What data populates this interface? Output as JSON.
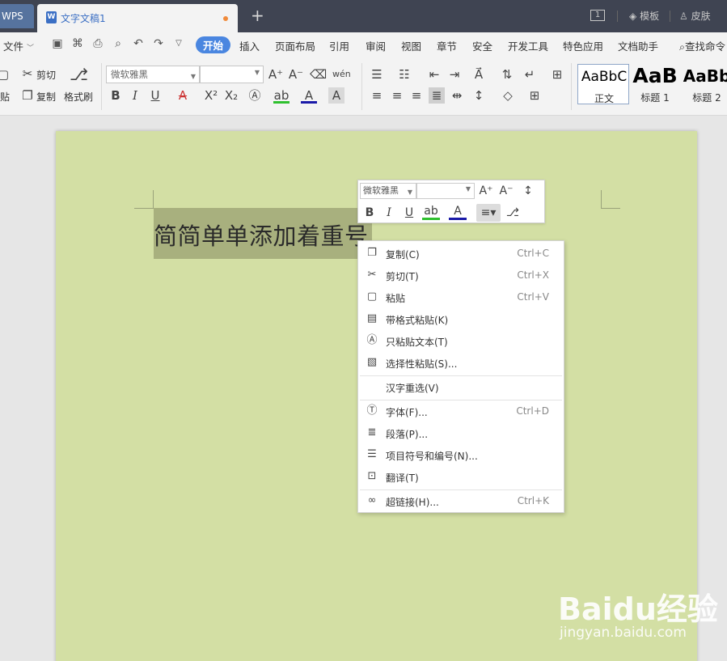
{
  "titlebar": {
    "app_tab": "WPS",
    "doc_tab": "文字文稿1",
    "doc_icon": "W",
    "add_tab": "+",
    "page_count": "1",
    "template": "模板",
    "skin": "皮肤"
  },
  "menubar": {
    "file": "文件",
    "tabs": [
      "开始",
      "插入",
      "页面布局",
      "引用",
      "审阅",
      "视图",
      "章节",
      "安全",
      "开发工具",
      "特色应用",
      "文档助手"
    ],
    "search": "查找命令"
  },
  "ribbon": {
    "cut": "剪切",
    "copy": "复制",
    "paste_frag": "贴",
    "format_painter": "格式刷",
    "font_name": "微软雅黑",
    "styles": [
      {
        "preview": "AaBbC",
        "caption": "正文"
      },
      {
        "preview": "AaB",
        "caption": "标题 1"
      },
      {
        "preview": "AaBb",
        "caption": "标题 2"
      }
    ]
  },
  "document": {
    "text": "简简单单添加着重号"
  },
  "mini_toolbar": {
    "font_name": "微软雅黑"
  },
  "context_menu": {
    "items": [
      {
        "label": "复制(C)",
        "shortcut": "Ctrl+C",
        "icon": "copy-icon"
      },
      {
        "label": "剪切(T)",
        "shortcut": "Ctrl+X",
        "icon": "scissors-icon"
      },
      {
        "label": "粘贴",
        "shortcut": "Ctrl+V",
        "icon": "paste-icon"
      },
      {
        "label": "带格式粘贴(K)",
        "shortcut": "",
        "icon": "paste-format-icon"
      },
      {
        "label": "只粘贴文本(T)",
        "shortcut": "",
        "icon": "paste-text-icon"
      },
      {
        "label": "选择性粘贴(S)...",
        "shortcut": "",
        "icon": "paste-special-icon"
      },
      {
        "label": "汉字重选(V)",
        "shortcut": "",
        "icon": ""
      },
      {
        "label": "字体(F)...",
        "shortcut": "Ctrl+D",
        "icon": "font-icon"
      },
      {
        "label": "段落(P)...",
        "shortcut": "",
        "icon": "paragraph-icon"
      },
      {
        "label": "项目符号和编号(N)...",
        "shortcut": "",
        "icon": "bullets-icon"
      },
      {
        "label": "翻译(T)",
        "shortcut": "",
        "icon": "translate-icon"
      },
      {
        "label": "超链接(H)...",
        "shortcut": "Ctrl+K",
        "icon": "link-icon"
      }
    ]
  },
  "watermark": {
    "brand": "Baidu经验",
    "url": "jingyan.baidu.com"
  }
}
